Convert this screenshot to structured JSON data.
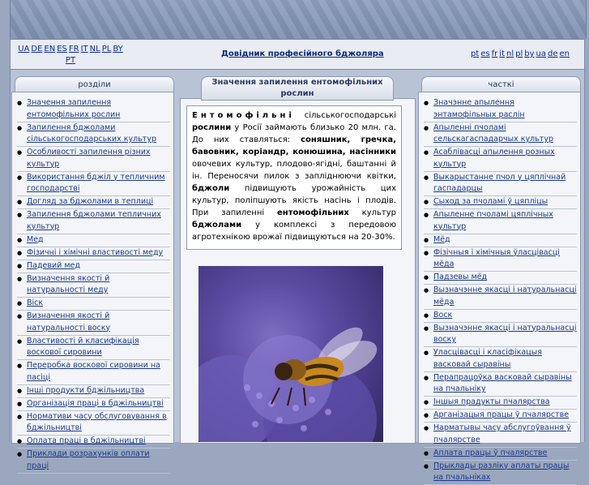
{
  "header": {
    "site_title": "Довідник професійного бджоляра",
    "langs_left": [
      "UA",
      "DE",
      "EN",
      "ES",
      "FR",
      "IT",
      "NL",
      "PL",
      "BY",
      "PT"
    ],
    "langs_right": [
      "pt",
      "es",
      "fr",
      "it",
      "nl",
      "pl",
      "by",
      "ua",
      "de",
      "en"
    ]
  },
  "left": {
    "title": "розділи",
    "items": [
      "Значення запилення ентомофільних рослин",
      "Запилення бджолами сільськогосподарських культур",
      "Особливості запилення різних культур",
      "Використання бджіл у тепличним господарстві",
      " Догляд за бджолами в теплиці",
      "Запилення бджолами тепличних культур",
      "Мед",
      "Фізичні і хімічні властивості меду",
      "Падевий мед",
      "Визначення якості й натуральності меду",
      "Віск",
      "Визначення якості й натуральності воску",
      "Властивості й класифікація воскової сировини",
      "Переробка воскової сировини на пасіці",
      "Інші продукти бджільництва",
      "Організація праці в бджільництві",
      "Нормативи часу обслуговування в бджільництві",
      "Оплата праці в бджільництві",
      "Приклади розрахунків оплати праці"
    ]
  },
  "center": {
    "title": "Значення запилення ентомофільних рослин",
    "p1_spaced": "Ентомофільні",
    "p1_a": " сільськогосподарські ",
    "p1_b": "рослини",
    "p1_c": " у Росії займають близько 20 млн. га. До них ставляться: ",
    "crops": "соняшник, гречка, бавовник, коріандр, конюшина, насінники",
    "p1_d": " овочевих культур, плодово-ягідні, баштанні й ін. Переносячи пилок з запліднюючи квітки, ",
    "p1_e": "бджоли",
    "p1_f": " підвищують урожайність цих культур, поліпшують якість насінь і плодів. При запиленні ",
    "p1_g": "ентомофільних",
    "p1_h": " культур ",
    "p1_i": "бджолами",
    "p1_j": " у комплексі з передовою агротехнікою врожаї підвищуються на 20-30%."
  },
  "right": {
    "title": "часткі",
    "items": [
      "Значэнне апылення энтамофільных раслін",
      "Апыленні пчоламі сельскагаспадарчых культур",
      "Асаблівасці апылення розных культур",
      "Выкарыстанне пчол у цяплічнай гаспадарцы",
      "Сыход за пчоламі ў цяпліцы",
      "Апыленне пчоламі цяплічных культур",
      "Мёд",
      "Фізічныя і хімічныя ўласцівасці мёда",
      "Падзевы мёд",
      "Вызначэнне якасці і натуральнасці мёда",
      "Воск",
      "Вызначэнне якасці і натуральнасці воску",
      "Уласцівасці і класіфікацыя васковай сыравіны",
      "Перапрацоўка васковай сыравіны на пчальніку",
      "Іншыя прадукты пчалярства",
      "Арганізацыя працы ў пчалярстве",
      "Нарматывы часу абслугоўвання ў пчалярстве",
      "Аплата працы ў пчалярстве",
      "Прыклады разліку аплаты працы на пчальніках"
    ]
  }
}
